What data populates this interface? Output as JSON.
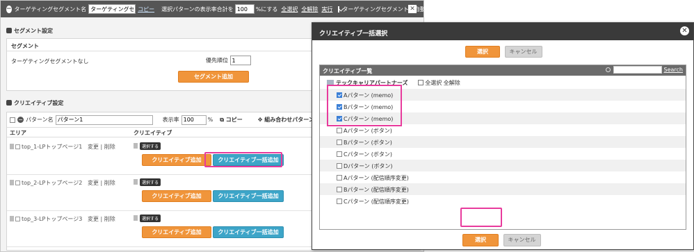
{
  "top_bar": {
    "segment_name_label": "ターゲティングセグメント名",
    "segment_name_value": "ターゲティングセグメ",
    "copy_link": "コピー",
    "ratio_prefix": "選択パターンの表示率合計を",
    "ratio_value": "100",
    "ratio_suffix": "%にする",
    "select_all": "全選択",
    "deselect_all": "全解除",
    "execute": "実行",
    "auto_input_label": "ターゲティングセグメント名自動入力"
  },
  "segment_settings": {
    "heading": "セグメント設定",
    "box_header": "セグメント",
    "none_label": "ターゲティングセグメントなし",
    "priority_label": "優先順位",
    "priority_value": "1",
    "add_button": "セグメント追加"
  },
  "creative_settings": {
    "heading": "クリエイティブ設定",
    "pattern_label": "パターン名",
    "pattern_value": "パターン1",
    "display_rate_label": "表示率",
    "display_rate_value": "100",
    "percent": "%",
    "copy_label": "コピー",
    "combo_label": "組み合わせパターン",
    "col_area": "エリア",
    "col_creative": "クリエイティブ",
    "rows": [
      {
        "area": "top_1-LPトップページ1",
        "change": "変更",
        "sep": "|",
        "delete": "削除",
        "select_tag": "選択する",
        "add_btn": "クリエイティブ追加",
        "bulk_btn": "クリエイティブ一括追加"
      },
      {
        "area": "top_2-LPトップページ2",
        "change": "変更",
        "sep": "|",
        "delete": "削除",
        "select_tag": "選択する",
        "add_btn": "クリエイティブ追加",
        "bulk_btn": "クリエイティブ一括追加"
      },
      {
        "area": "top_3-LPトップページ3",
        "change": "変更",
        "sep": "|",
        "delete": "削除",
        "select_tag": "選択する",
        "add_btn": "クリエイティブ追加",
        "bulk_btn": "クリエイティブ一括追加"
      }
    ]
  },
  "dialog": {
    "title": "クリエイティブ一括選択",
    "select_btn": "選択",
    "cancel_btn": "キャンセル",
    "list_header": "クリエイティブ一覧",
    "search_link": "Search",
    "group_name": "テックキャリアパートナーズ",
    "group_select_all": "全選択",
    "group_deselect_all": "全解除",
    "items": [
      {
        "label": "Aパターン (memo)",
        "checked": true
      },
      {
        "label": "Bパターン (memo)",
        "checked": true
      },
      {
        "label": "Cパターン (memo)",
        "checked": true
      },
      {
        "label": "Aパターン (ボタン)",
        "checked": false
      },
      {
        "label": "Bパターン (ボタン)",
        "checked": false
      },
      {
        "label": "Cパターン (ボタン)",
        "checked": false
      },
      {
        "label": "Dパターン (ボタン)",
        "checked": false
      },
      {
        "label": "Aパターン (配信順序変更)",
        "checked": false
      },
      {
        "label": "Bパターン (配信順序変更)",
        "checked": false
      },
      {
        "label": "Cパターン (配信順序変更)",
        "checked": false
      }
    ]
  },
  "colors": {
    "orange": "#f0953b",
    "blue": "#3da5c8",
    "highlight": "#e83a9c",
    "title_bar": "#3a3a3a"
  }
}
